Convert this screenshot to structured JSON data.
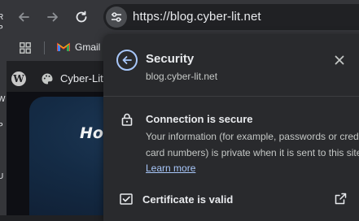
{
  "browser": {
    "url": "https://blog.cyber-lit.net",
    "bookmarks": [
      {
        "label": "Gmail"
      }
    ],
    "tab": {
      "title": "Cyber-Lit"
    }
  },
  "page": {
    "hero_text": "Hor"
  },
  "security_popup": {
    "title": "Security",
    "domain": "blog.cyber-lit.net",
    "connection_title": "Connection is secure",
    "connection_text": "Your information (for example, passwords or credit card numbers) is private when it is sent to this site.",
    "learn_more": "Learn more",
    "certificate_label": "Certificate is valid"
  },
  "background_window": {
    "sliver_texts": [
      "R",
      "P",
      "W",
      "P",
      "U",
      "I"
    ]
  },
  "colors": {
    "accent": "#a8c7fa",
    "popup_bg": "#292a2d",
    "toolbar_bg": "#35363a"
  }
}
